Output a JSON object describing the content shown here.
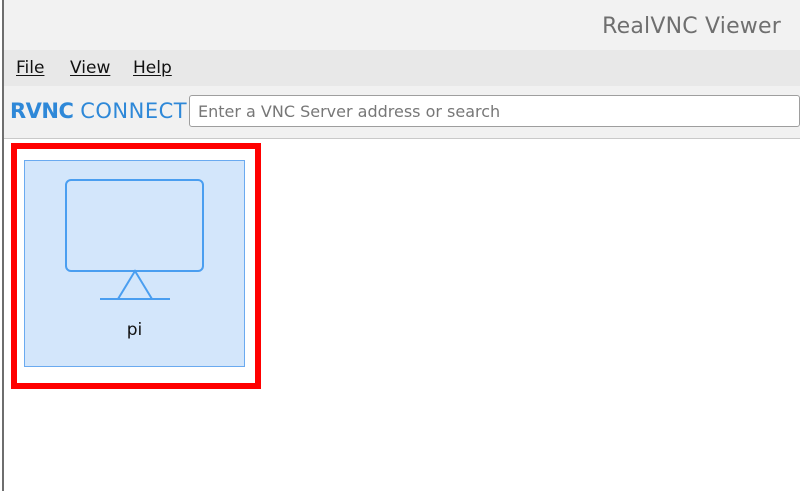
{
  "window": {
    "title": "RealVNC Viewer"
  },
  "menu": {
    "file": "File",
    "view": "View",
    "help": "Help"
  },
  "toolbar": {
    "logo_main": "RVNC",
    "logo_accent": "CONNECT",
    "search_placeholder": "Enter a VNC Server address or search",
    "search_value": ""
  },
  "address_book": {
    "computers": [
      {
        "name": "pi",
        "icon": "monitor-icon",
        "selected": true
      }
    ]
  },
  "colors": {
    "accent": "#2e88d8",
    "tile_selected_bg": "#d3e6fb",
    "tile_border": "#6aaaf0",
    "highlight": "#ff0000"
  }
}
